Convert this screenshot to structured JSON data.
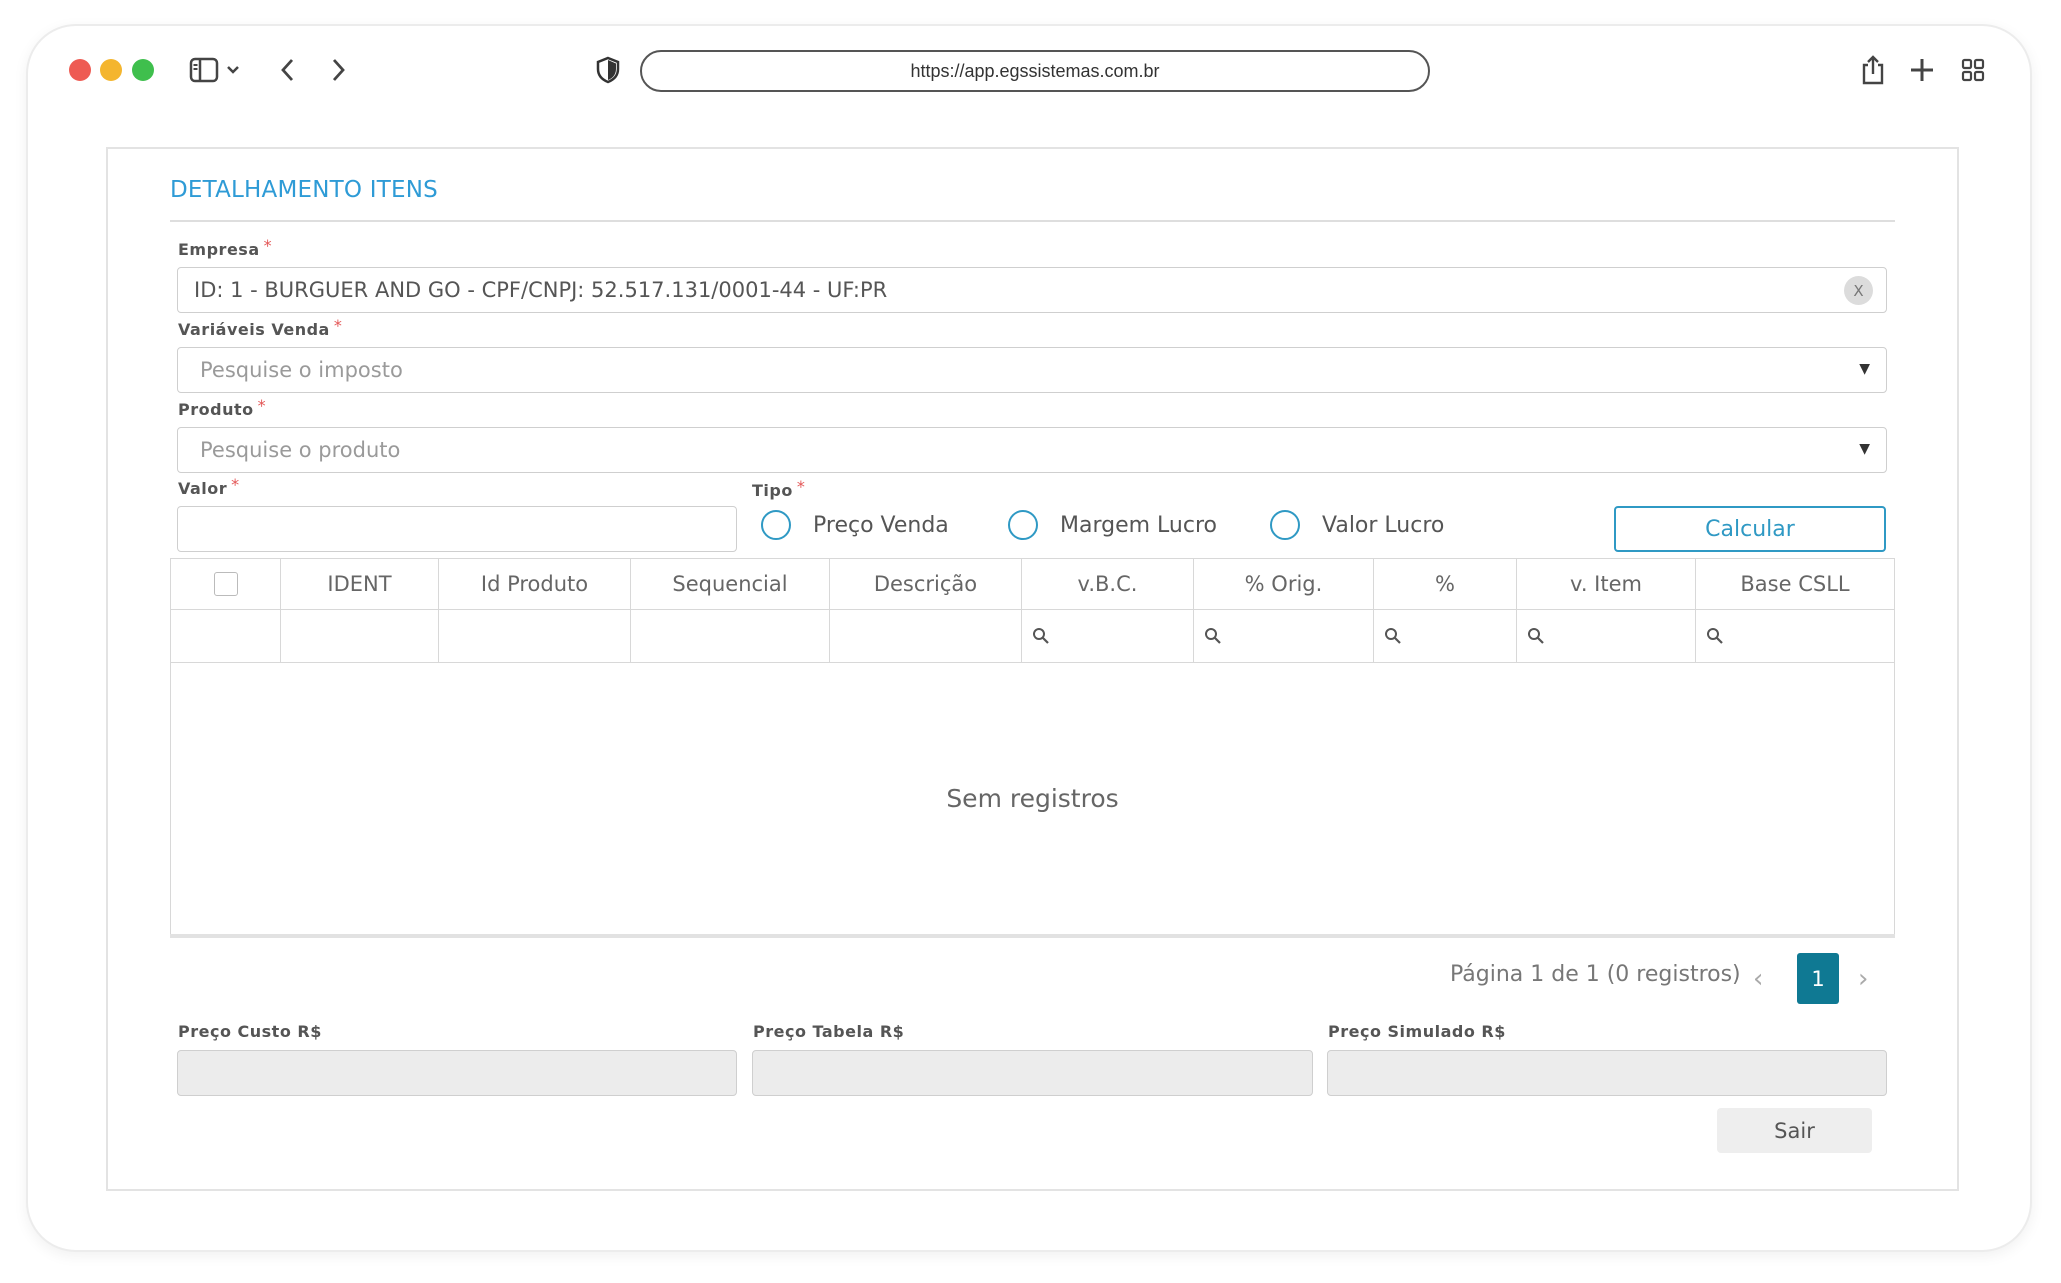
{
  "browser": {
    "url": "https://app.egssistemas.com.br"
  },
  "page": {
    "title": "DETALHAMENTO ITENS"
  },
  "form": {
    "empresa": {
      "label": "Empresa",
      "required_mark": "*",
      "value": "ID: 1 - BURGUER AND GO - CPF/CNPJ: 52.517.131/0001-44 - UF:PR",
      "clear_label": "X"
    },
    "variaveis_venda": {
      "label": "Variáveis Venda",
      "required_mark": "*",
      "placeholder": "Pesquise o imposto"
    },
    "produto": {
      "label": "Produto",
      "required_mark": "*",
      "placeholder": "Pesquise o produto"
    },
    "valor": {
      "label": "Valor",
      "required_mark": "*",
      "value": ""
    },
    "tipo": {
      "label": "Tipo",
      "required_mark": "*",
      "options": [
        "Preço Venda",
        "Margem Lucro",
        "Valor Lucro"
      ],
      "selected": null
    },
    "calcular_label": "Calcular"
  },
  "grid": {
    "columns": [
      "",
      "IDENT",
      "Id Produto",
      "Sequencial",
      "Descrição",
      "v.B.C.",
      "% Orig.",
      "%",
      "v. Item",
      "Base CSLL"
    ],
    "filterable_columns": [
      "v.B.C.",
      "% Orig.",
      "%",
      "v. Item",
      "Base CSLL"
    ],
    "rows": [],
    "empty_message": "Sem registros"
  },
  "pager": {
    "info": "Página 1 de 1 (0 registros)",
    "current_page": "1",
    "prev_symbol": "‹",
    "next_symbol": "›"
  },
  "summary": {
    "preco_custo_label": "Preço Custo R$",
    "preco_tabela_label": "Preço Tabela R$",
    "preco_simulado_label": "Preço Simulado R$",
    "preco_custo_value": "",
    "preco_tabela_value": "",
    "preco_simulado_value": ""
  },
  "actions": {
    "sair_label": "Sair"
  },
  "colors": {
    "accent": "#2f99c4",
    "title": "#2e9bd6",
    "page_active": "#0f7993",
    "required": "#e35656"
  }
}
